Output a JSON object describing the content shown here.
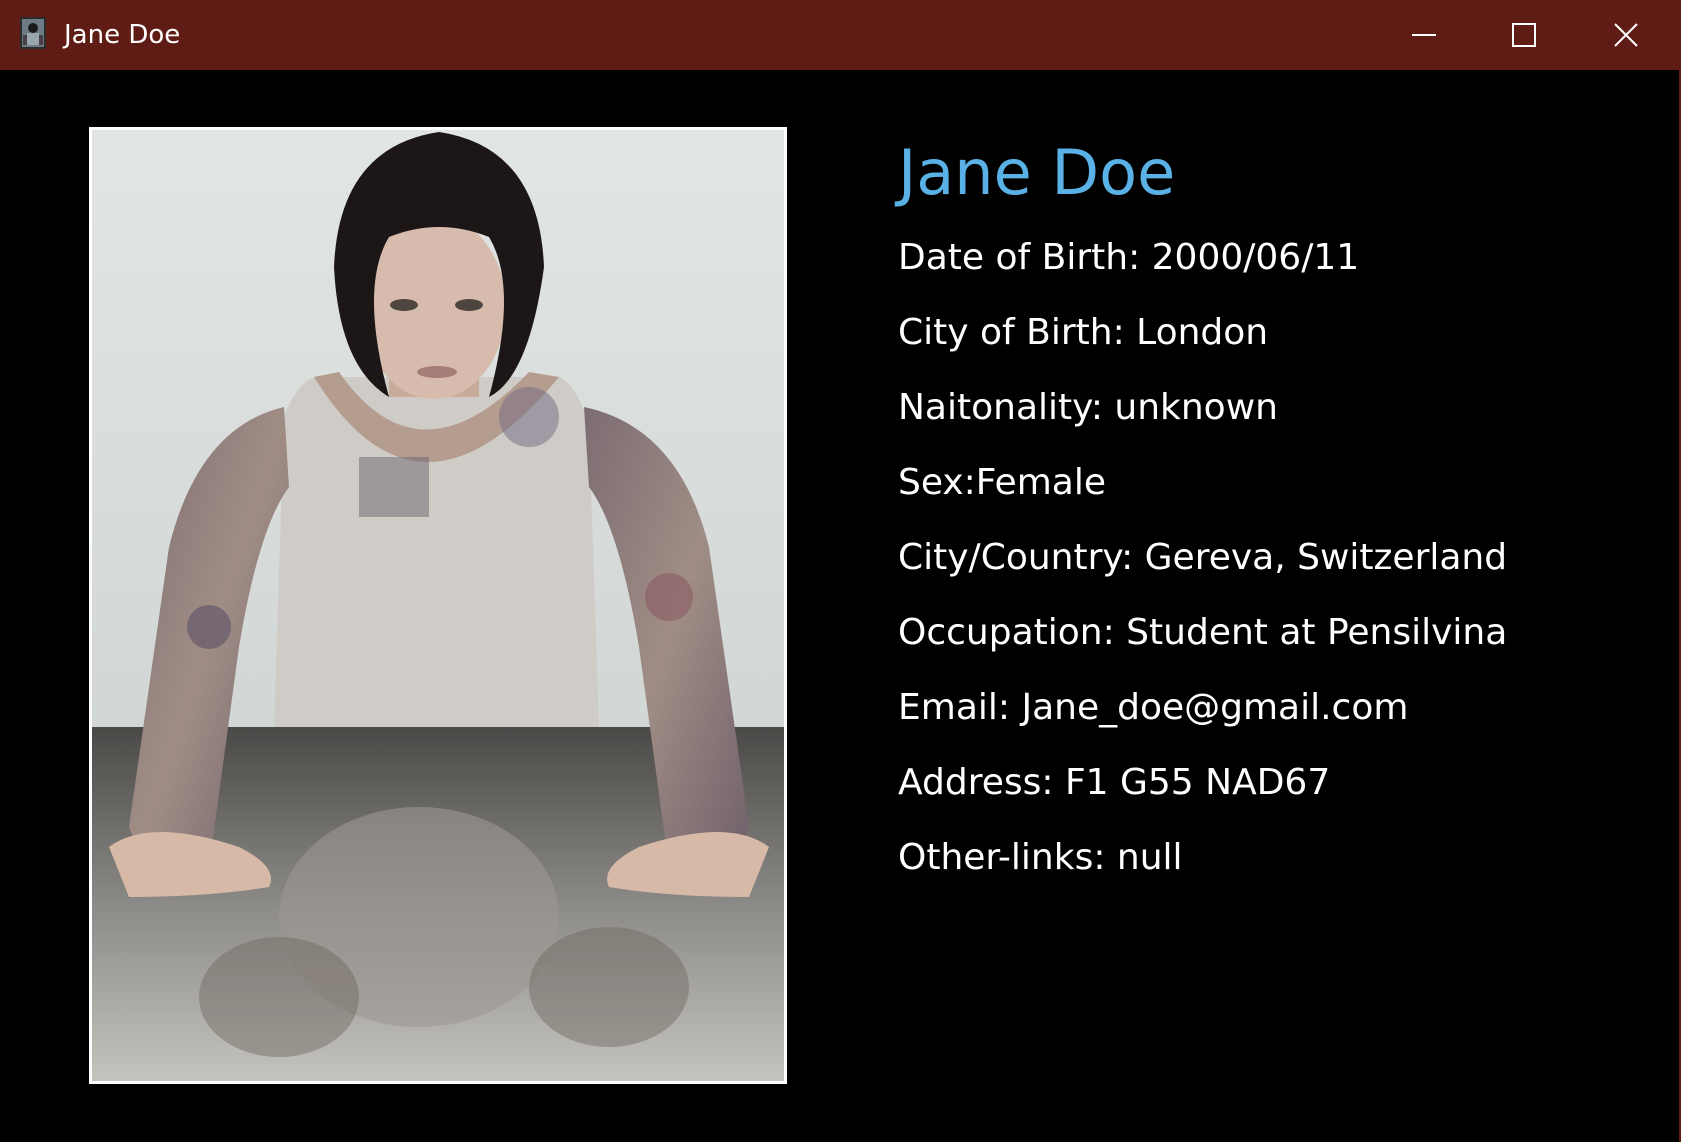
{
  "window": {
    "title": "Jane Doe",
    "colors": {
      "titlebar": "#5e1c15",
      "background": "#000000",
      "name_accent": "#5ab1e6",
      "text": "#ffffff"
    },
    "controls": {
      "minimize_icon": "minimize-icon",
      "maximize_icon": "maximize-icon",
      "close_icon": "close-icon"
    }
  },
  "profile": {
    "name": "Jane Doe",
    "photo_icon": "profile-photo",
    "fields": [
      "Date of Birth: 2000/06/11",
      "City of Birth: London",
      "Naitonality: unknown",
      "Sex:Female",
      "City/Country: Gereva, Switzerland",
      "Occupation: Student at Pensilvina",
      "Email: Jane_doe@gmail.com",
      "Address: F1 G55 NAD67",
      "Other-links: null"
    ]
  }
}
